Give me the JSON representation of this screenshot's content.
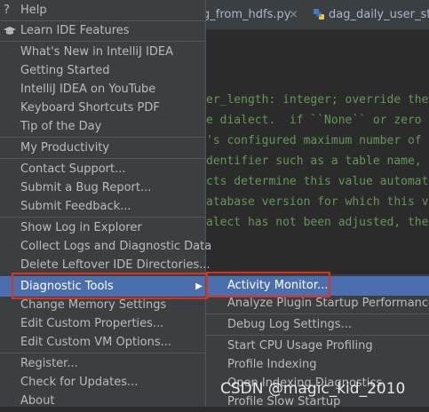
{
  "editor": {
    "tabs": [
      {
        "label": "g_from_hdfs.py",
        "close": "×"
      },
      {
        "label": "dag_daily_user_stat."
      }
    ],
    "code_lines": [
      "er_length: integer; override the",
      "e dialect.  if ``None`` or zero",
      "'s configured maximum number of",
      "dentifier such as a table name,",
      "cts determine this value automat",
      "atabase version for which this v",
      "alect has not been adjusted, the"
    ]
  },
  "menu": {
    "help": "Help",
    "learn": "Learn IDE Features",
    "items_group1": [
      "What's New in IntelliJ IDEA",
      "Getting Started",
      "IntelliJ IDEA on YouTube",
      "Keyboard Shortcuts PDF",
      "Tip of the Day"
    ],
    "my_productivity": "My Productivity",
    "items_group2": [
      "Contact Support...",
      "Submit a Bug Report...",
      "Submit Feedback..."
    ],
    "items_group3": [
      "Show Log in Explorer",
      "Collect Logs and Diagnostic Data",
      "Delete Leftover IDE Directories..."
    ],
    "diagnostic_tools": "Diagnostic Tools",
    "items_group4": [
      "Change Memory Settings",
      "Edit Custom Properties...",
      "Edit Custom VM Options..."
    ],
    "items_group5": [
      "Register...",
      "Check for Updates...",
      "About"
    ]
  },
  "submenu": {
    "activity_monitor": "Activity Monitor...",
    "analyze_plugin": "Analyze Plugin Startup Performance",
    "debug_log": "Debug Log Settings...",
    "items": [
      "Start CPU Usage Profiling",
      "Profile Indexing",
      "Open Indexing Diagnostics",
      "Profile Slow Startup"
    ]
  },
  "watermark": "CSDN @magic_kid_2010",
  "colors": {
    "selection": "#4b6eaf",
    "highlight": "#e0301e",
    "menu_bg": "#3c3f41"
  }
}
